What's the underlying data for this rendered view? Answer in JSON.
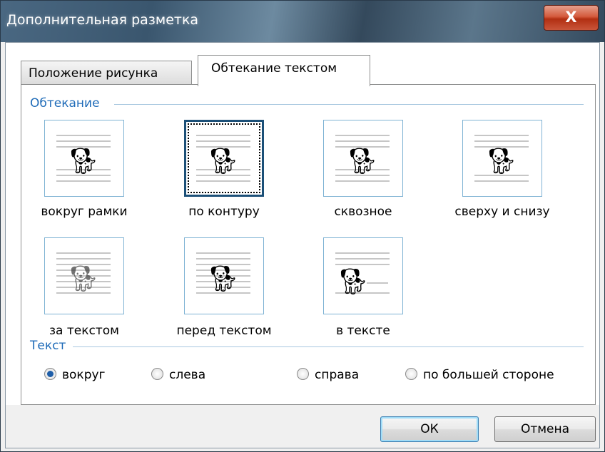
{
  "window": {
    "title": "Дополнительная разметка",
    "close_label": "X"
  },
  "tabs": [
    {
      "label": "Положение рисунка",
      "active": false
    },
    {
      "label": "Обтекание текстом",
      "active": true
    }
  ],
  "wrapping": {
    "group_label": "Обтекание",
    "options": [
      {
        "label": "вокруг рамки",
        "icon": "square-wrap-icon",
        "selected": false
      },
      {
        "label": "по контуру",
        "icon": "tight-wrap-icon",
        "selected": true
      },
      {
        "label": "сквозное",
        "icon": "through-wrap-icon",
        "selected": false
      },
      {
        "label": "сверху и снизу",
        "icon": "top-bottom-wrap-icon",
        "selected": false
      },
      {
        "label": "за текстом",
        "icon": "behind-text-icon",
        "selected": false
      },
      {
        "label": "перед текстом",
        "icon": "in-front-of-text-icon",
        "selected": false
      },
      {
        "label": "в тексте",
        "icon": "inline-with-text-icon",
        "selected": false
      }
    ]
  },
  "text": {
    "group_label": "Текст",
    "radios": [
      {
        "label": "вокруг",
        "checked": true
      },
      {
        "label": "слева",
        "checked": false
      },
      {
        "label": "справа",
        "checked": false
      },
      {
        "label": "по большей стороне",
        "checked": false
      }
    ]
  },
  "buttons": {
    "ok": "ОК",
    "cancel": "Отмена"
  },
  "colors": {
    "group_label": "#1f6bb8",
    "option_border": "#7fb3d4",
    "selected_border": "#1b4f77"
  }
}
